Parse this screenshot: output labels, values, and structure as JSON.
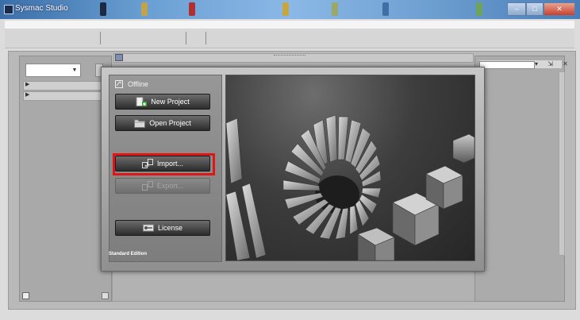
{
  "window": {
    "title": "Sysmac Studio",
    "control_glyphs": {
      "minimize": "–",
      "maximize": "□",
      "close": "✕"
    }
  },
  "layout_panels": {
    "left_tree_arrows": [
      "▶",
      "▶"
    ],
    "right_panel_buttons": "▾ ⇲ ✕"
  },
  "start_page": {
    "mode_label": "Offline",
    "buttons": [
      {
        "label": "New Project",
        "icon": "new-project-icon",
        "enabled": true
      },
      {
        "label": "Open Project",
        "icon": "folder-icon",
        "enabled": true
      },
      {
        "label": "Import...",
        "icon": "import-icon",
        "enabled": true,
        "highlighted": true
      },
      {
        "label": "Export...",
        "icon": "export-icon",
        "enabled": false
      },
      {
        "label": "License",
        "icon": "license-key-icon",
        "enabled": true
      }
    ],
    "edition": "Standard Edition"
  },
  "colors": {
    "title_bar": "#5d92cc",
    "dialog_button": "#3c3c3c",
    "highlight": "#e01515"
  }
}
